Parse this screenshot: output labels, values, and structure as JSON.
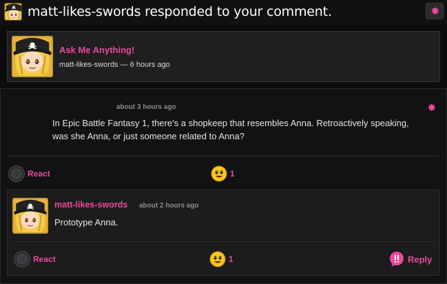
{
  "header": {
    "title": "matt-likes-swords responded to your comment."
  },
  "post": {
    "title": "Ask Me Anything!",
    "author": "matt-likes-swords",
    "separator": "—",
    "time": "6 hours ago"
  },
  "comment": {
    "time": "about 3 hours ago",
    "body": "In Epic Battle Fantasy 1, there's a shopkeep that resembles Anna. Retroactively speaking, was she Anna, or just someone related to Anna?",
    "react_label": "React",
    "reaction_count": "1"
  },
  "reply": {
    "author": "matt-likes-swords",
    "time": "about 2 hours ago",
    "text": "Prototype Anna.",
    "react_label": "React",
    "reaction_count": "1",
    "reply_label": "Reply"
  },
  "colors": {
    "accent": "#e94b9c",
    "background": "#0d0c0d",
    "card": "#1f1e20"
  },
  "icons": {
    "header_settings": "gear-icon",
    "comment_settings": "gear-icon",
    "reaction": "smiley-icon",
    "reply": "speech-bubble-icon"
  }
}
